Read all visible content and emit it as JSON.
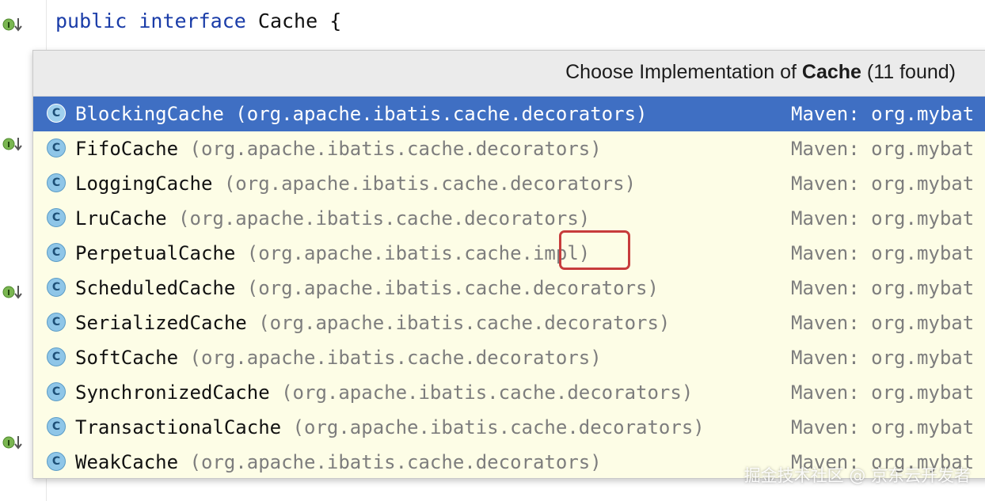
{
  "editor": {
    "code_keyword_public": "public",
    "code_keyword_interface": "interface",
    "code_rest": " Cache {"
  },
  "popup": {
    "title_prefix": "Choose Implementation of ",
    "title_bold": "Cache",
    "title_suffix": " (11 found)",
    "items": [
      {
        "name": "BlockingCache",
        "package": "(org.apache.ibatis.cache.decorators)",
        "library": "Maven: org.mybat",
        "icon": "C"
      },
      {
        "name": "FifoCache",
        "package": "(org.apache.ibatis.cache.decorators)",
        "library": "Maven: org.mybat",
        "icon": "C"
      },
      {
        "name": "LoggingCache",
        "package": "(org.apache.ibatis.cache.decorators)",
        "library": "Maven: org.mybat",
        "icon": "C"
      },
      {
        "name": "LruCache",
        "package": "(org.apache.ibatis.cache.decorators)",
        "library": "Maven: org.mybat",
        "icon": "C"
      },
      {
        "name": "PerpetualCache",
        "package": "(org.apache.ibatis.cache.impl)",
        "library": "Maven: org.mybat",
        "icon": "C"
      },
      {
        "name": "ScheduledCache",
        "package": "(org.apache.ibatis.cache.decorators)",
        "library": "Maven: org.mybat",
        "icon": "C"
      },
      {
        "name": "SerializedCache",
        "package": "(org.apache.ibatis.cache.decorators)",
        "library": "Maven: org.mybat",
        "icon": "C"
      },
      {
        "name": "SoftCache",
        "package": "(org.apache.ibatis.cache.decorators)",
        "library": "Maven: org.mybat",
        "icon": "C"
      },
      {
        "name": "SynchronizedCache",
        "package": "(org.apache.ibatis.cache.decorators)",
        "library": "Maven: org.mybat",
        "icon": "C"
      },
      {
        "name": "TransactionalCache",
        "package": "(org.apache.ibatis.cache.decorators)",
        "library": "Maven: org.mybat",
        "icon": "C"
      },
      {
        "name": "WeakCache",
        "package": "(org.apache.ibatis.cache.decorators)",
        "library": "Maven: org.mybat",
        "icon": "C"
      }
    ],
    "selected_index": 0
  },
  "watermark": "掘金技术社区 @ 京东云开发者",
  "colors": {
    "selection": "#3f6fc3",
    "popup_background": "#fdfde6",
    "class_icon": "#8fc6e8",
    "highlight_box": "#c73c3c",
    "gutter_icon": "#6aa84f"
  },
  "gutter_icons": [
    "implemented-interface-icon",
    "implemented-interface-icon",
    "implemented-interface-icon",
    "implemented-interface-icon"
  ]
}
